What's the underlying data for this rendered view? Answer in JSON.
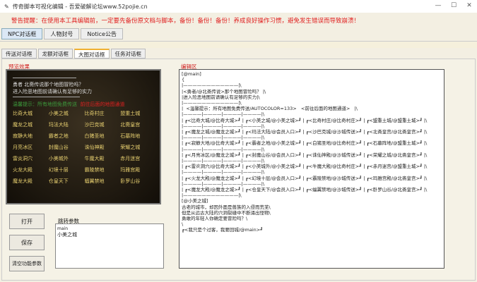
{
  "window": {
    "title": "传奇脚本可视化编辑 - 吾爱破解论坛www.52pojie.cn",
    "controls": [
      "—",
      "☐",
      "✕"
    ]
  },
  "warning": "警告提醒：在使用本工具编辑前，一定要先备份原文档与脚本，备份！备份！备份！养成良好操作习惯，避免发生错误而导致崩溃！",
  "tabs": [
    {
      "label": "NPC对话框",
      "active": true
    },
    {
      "label": "人物封号"
    },
    {
      "label": "Notice公告"
    }
  ],
  "subtabs": [
    {
      "label": "传送对话框"
    },
    {
      "label": "龙额对话框"
    },
    {
      "label": "大图对话框",
      "active": true
    },
    {
      "label": "任务对话框"
    }
  ],
  "preview": {
    "label": "预览效果",
    "intro": [
      "勇者 北斋传说那个地图冒险吗？",
      "进入险恶地图前请确认有足够的实力"
    ],
    "tip": "温馨提示：所有地图免费传送",
    "tip_red": "前往后面的地图通道",
    "rows": [
      [
        "比奇大城",
        "小美之城",
        "比奇村庄",
        "盟重土城"
      ],
      [
        "魔龙之城",
        "玛法大陆",
        "沙巴克城",
        "北斋皇宫"
      ],
      [
        "寂静大地",
        "霸者之地",
        "白猪圣地",
        "石墓阵地"
      ],
      [
        "月亮冰区",
        "封魔山谷",
        "诛仙神殿",
        "荣耀之城"
      ],
      [
        "雷炎洞穴",
        "小美城外",
        "牛魔大殿",
        "赤月迷宫"
      ],
      [
        "火龙大殿",
        "幻境十层",
        "霸陵禁地",
        "玛雅宫殿"
      ],
      [
        "魔龙大殿",
        "仓皇天下",
        "蝠翼禁地",
        "卧罗山谷"
      ]
    ]
  },
  "editor": {
    "label": "编辑区",
    "text": "[@main]\n{\n|————————————|\\\n|<勇者/@北斋传说>那个地图冒险吗？ |\\\n|进入险恶地图前请确认有足够的实力|\\\n|————————————|\\\n|  <温馨提示：所有地图免费传送/AUTOCOLOR=133>   <前往后面的地图通道>   |\\\n|————|————|————|————|\\\n| ┏<比奇大城/@比奇大城>┛ | ┏<小美之城/@小美之城>┛ | ┏<比奇村庄/@比奇村庄>┛ | ┏<盟重土城/@盟重土城>┛ |\\\n|————|————|————|————|\\\n| ┏<魔龙之城/@魔龙之城>┛ | ┏<玛法大陆/@会员入口>┛ | ┏<沙巴克城/@沙城传送>┛ | ┏<北斋皇宫/@北斋皇宫>┛ |\\\n|————|————|————|————|\\\n| ┏<寂静大地/@比奇大城>┛ | ┏<霸者之地/@小美之城>┛ | ┏<白猪圣地/@比奇村庄>┛ | ┏<石墓阵地/@盟重土城>┛ |\\\n|————|————|————|————|\\\n| ┏<月亮冰区/@魔龙之城>┛ | ┏<封魔山谷/@会员入口>┛ | ┏<诛仙神殿/@沙城传送>┛ | ┏<荣耀之城/@北斋皇宫>┛ |\\\n|————|————|————|————|\\\n| ┏<雷炎洞穴/@比奇大城>┛ | ┏<小美城外/@小美之城>┛ | ┏<牛魔大殿/@比奇村庄>┛ | ┏<赤月迷宫/@盟重土城>┛ |\\\n|————|————|————|————|\\\n| ┏<火龙大殿/@魔龙之城>┛ | ┏<幻境十层/@会员入口>┛ | ┏<霸陵禁地/@沙城传送>┛ | ┏<玛雅宫殿/@北斋皇宫>┛ |\\\n|————|————|————|————|\\\n| ┏<魔龙大殿/@魔龙之城>┛ | ┏<仓皇天下/@会员入口>┛ | ┏<蝠翼禁地/@沙城传送>┛ | ┏<卧罗山谷/@北斋皇宫>┛ |\\\n|————————————|\\\n[@小美之城]\n古老的城市，却因外面是兽族的入侵而荒芜\\\n但是从远古大陆的穴洞裂缝中不断涌出怪物\\\n勇敢的年轻人你确定要冒险吗？\\\n\\\n┏<我只是个过客，我要回城/@main>┛"
  },
  "buttons": {
    "open": "打开",
    "save": "保存",
    "clear": "清空功能参数"
  },
  "params": {
    "label": "跳转参数",
    "lines": [
      "main",
      "小美之城"
    ]
  }
}
